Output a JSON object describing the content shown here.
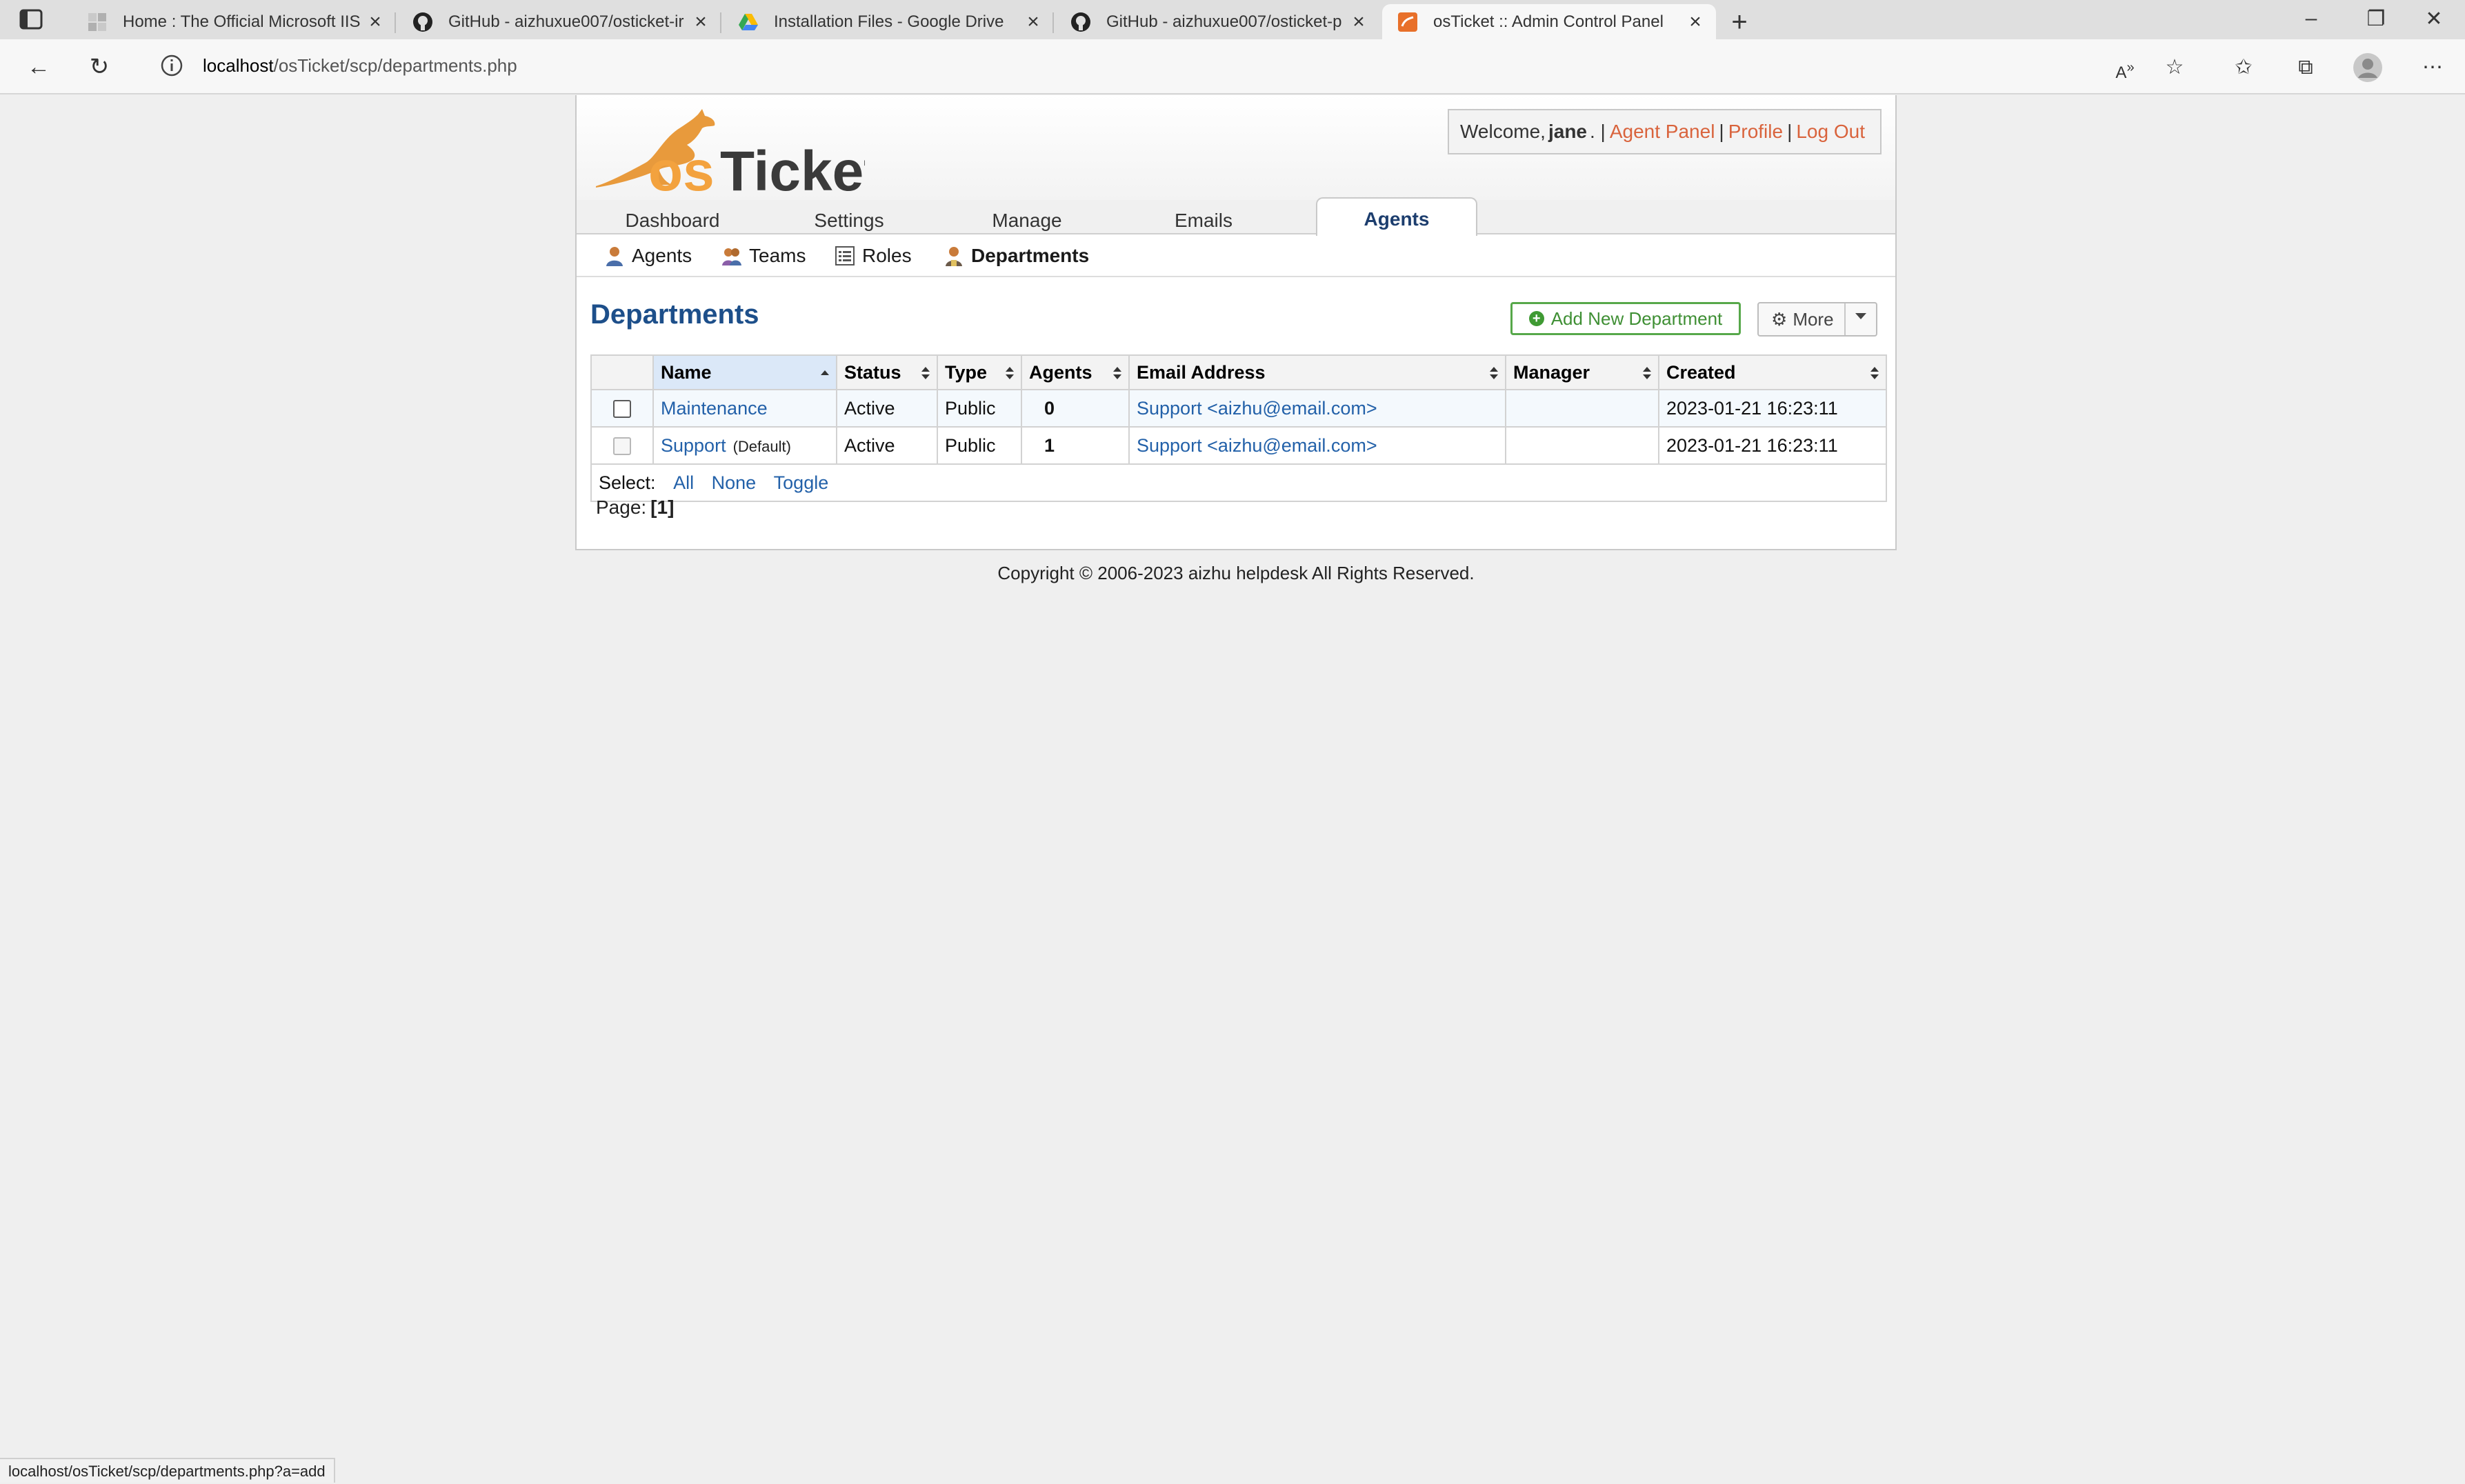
{
  "browser": {
    "tabs": [
      {
        "title": "Home : The Official Microsoft IIS",
        "icon": "page-icon"
      },
      {
        "title": "GitHub - aizhuxue007/osticket-ir",
        "icon": "github-icon"
      },
      {
        "title": "Installation Files - Google Drive",
        "icon": "google-drive-icon"
      },
      {
        "title": "GitHub - aizhuxue007/osticket-p",
        "icon": "github-icon"
      },
      {
        "title": "osTicket :: Admin Control Panel",
        "icon": "osticket-icon",
        "active": true
      }
    ],
    "url_host": "localhost",
    "url_path": "/osTicket/scp/departments.php",
    "status_url": "localhost/osTicket/scp/departments.php?a=add"
  },
  "header": {
    "logo_text": "osTicket",
    "welcome_prefix": "Welcome, ",
    "user": "jane",
    "welcome_suffix": ". |",
    "links": {
      "agent_panel": "Agent Panel",
      "profile": "Profile",
      "logout": "Log Out"
    },
    "sep": "|"
  },
  "nav": {
    "tabs": [
      "Dashboard",
      "Settings",
      "Manage",
      "Emails",
      "Agents"
    ],
    "active": "Agents"
  },
  "subnav": {
    "items": [
      "Agents",
      "Teams",
      "Roles",
      "Departments"
    ],
    "active": "Departments"
  },
  "main": {
    "title": "Departments",
    "add_button": "Add New Department",
    "more_button": "More"
  },
  "table": {
    "columns": [
      "Name",
      "Status",
      "Type",
      "Agents",
      "Email Address",
      "Manager",
      "Created"
    ],
    "rows": [
      {
        "name": "Maintenance",
        "default": "",
        "status": "Active",
        "type": "Public",
        "agents": "0",
        "email": "Support <aizhu@email.com>",
        "manager": "",
        "created": "2023-01-21 16:23:11"
      },
      {
        "name": "Support",
        "default": "(Default)",
        "status": "Active",
        "type": "Public",
        "agents": "1",
        "email": "Support <aizhu@email.com>",
        "manager": "",
        "created": "2023-01-21 16:23:11"
      }
    ],
    "select_label": "Select:",
    "select_all": "All",
    "select_none": "None",
    "select_toggle": "Toggle"
  },
  "pager": {
    "label": "Page:",
    "current": "[1]"
  },
  "footer": {
    "copyright": "Copyright © 2006-2023 aizhu helpdesk All Rights Reserved."
  },
  "colors": {
    "link": "#2361a9",
    "accent_orange": "#d9633c",
    "title_blue": "#1d4f8a",
    "add_green": "#3f8f34"
  }
}
